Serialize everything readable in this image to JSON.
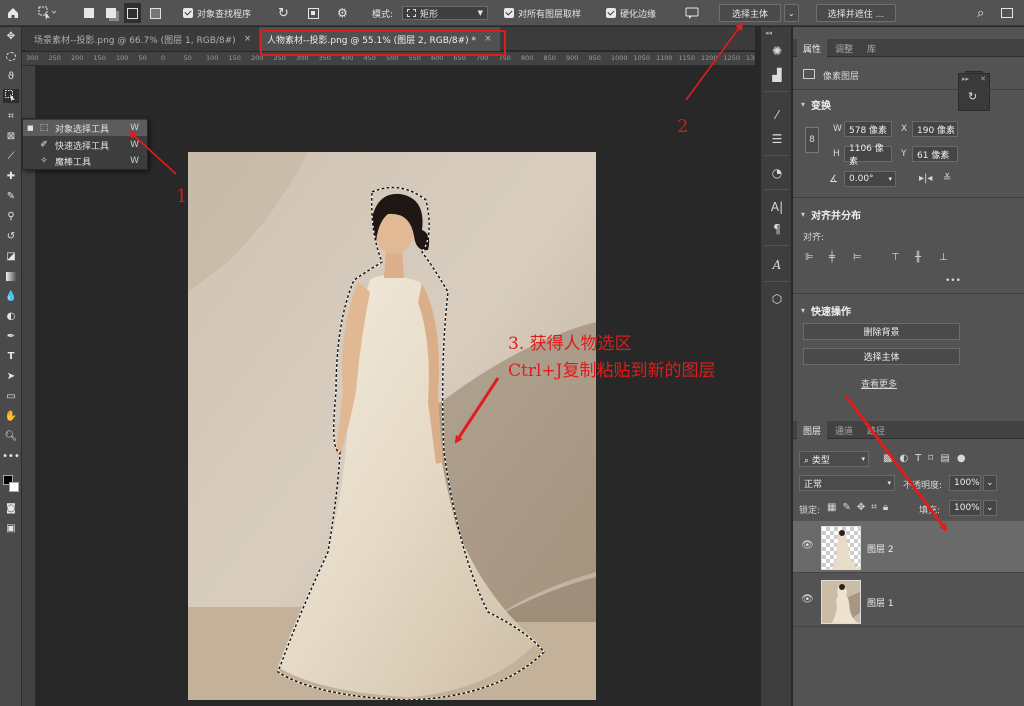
{
  "options_bar": {
    "object_finder_label": "对象查找程序",
    "mode_label": "模式:",
    "mode_value": "矩形",
    "sample_all_layers_label": "对所有图层取样",
    "hard_edge_label": "硬化边缘",
    "select_subject_button": "选择主体",
    "select_and_mask_button": "选择并遮住 ..."
  },
  "tabs": [
    {
      "label": "场景素材--投影.png @ 66.7% (图层 1, RGB/8#)",
      "close": "×"
    },
    {
      "label": "人物素材--投影.png @ 55.1% (图层 2, RGB/8#) *",
      "close": "×"
    }
  ],
  "ruler_ticks": [
    "300",
    "250",
    "200",
    "150",
    "100",
    "50",
    "0",
    "50",
    "100",
    "150",
    "200",
    "250",
    "300",
    "350",
    "400",
    "450",
    "500",
    "550",
    "600",
    "650",
    "700",
    "750",
    "800",
    "850",
    "900",
    "950",
    "1000",
    "1050",
    "1100",
    "1150",
    "1200",
    "1250",
    "1300"
  ],
  "flyout": {
    "items": [
      {
        "label": "对象选择工具",
        "key": "W",
        "icon": "object-selection-icon"
      },
      {
        "label": "快速选择工具",
        "key": "W",
        "icon": "quick-selection-icon"
      },
      {
        "label": "魔棒工具",
        "key": "W",
        "icon": "magic-wand-icon"
      }
    ]
  },
  "annotations": {
    "num1": "1",
    "num2": "2",
    "step3_line1": "3. 获得人物选区",
    "step3_line2": "Ctrl+J复制粘贴到新的图层",
    "color": "#e01c1c"
  },
  "properties": {
    "tabs": [
      "属性",
      "调整",
      "库"
    ],
    "layer_type": "像素图层",
    "transform_title": "变换",
    "w_label": "W",
    "w_value": "578 像素",
    "x_label": "X",
    "x_value": "190 像素",
    "h_label": "H",
    "h_value": "1106 像素",
    "y_label": "Y",
    "y_value": "61 像素",
    "angle_value": "0.00°",
    "align_title": "对齐并分布",
    "align_label": "对齐:",
    "more": "•••",
    "quick_actions_title": "快速操作",
    "remove_bg_button": "删除背景",
    "select_subject_button": "选择主体",
    "view_more_link": "查看更多"
  },
  "layers": {
    "tabs": [
      "图层",
      "通道",
      "路径"
    ],
    "filter_kind": "类型",
    "blend_mode": "正常",
    "opacity_label": "不透明度:",
    "opacity_value": "100%",
    "lock_label": "锁定:",
    "fill_label": "填充:",
    "fill_value": "100%",
    "items": [
      {
        "name": "图层 2",
        "selected": true
      },
      {
        "name": "图层 1",
        "selected": false
      }
    ]
  }
}
